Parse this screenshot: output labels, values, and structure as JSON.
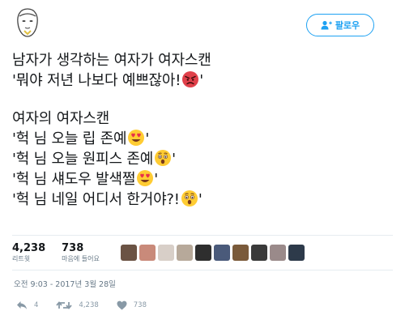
{
  "header": {
    "follow_label": "팔로우"
  },
  "tweet": {
    "lines": [
      "남자가 생각하는 여자가 여자스캔",
      "'뭐야 저년 나보다 예쁘잖아!",
      "여자의 여자스캔",
      "'헉 님 오늘 립 존예",
      "'헉 님 오늘 원피스 존예",
      "'헉 님 섀도우 발색쩔",
      "'헉 님 네일 어디서 한거야?!"
    ],
    "line_suffixes": [
      "",
      "'",
      "",
      "'",
      "'",
      "'",
      "'"
    ],
    "emoji_names": [
      "",
      "angry-face-icon",
      "",
      "heart-eyes-icon",
      "astonished-face-icon",
      "heart-eyes-icon",
      "astonished-face-icon"
    ]
  },
  "stats": {
    "retweets": {
      "count": "4,238",
      "label": "리트윗"
    },
    "likes": {
      "count": "738",
      "label": "마음에 들어요"
    }
  },
  "likers": {
    "count": 10,
    "colors": [
      "#6b5344",
      "#c98a7a",
      "#d8cfc8",
      "#b7a99a",
      "#2e2e2e",
      "#4a5a7a",
      "#7a5a3a",
      "#3a3a3a",
      "#9a8a8a",
      "#2d3a4a"
    ]
  },
  "timestamp": "오전 9:03 - 2017년 3월 28일",
  "actions": {
    "reply_count": "4",
    "retweet_count": "4,238",
    "like_count": "738"
  },
  "colors": {
    "accent": "#1da1f2",
    "muted": "#657786",
    "icon_muted": "#8899a6"
  }
}
